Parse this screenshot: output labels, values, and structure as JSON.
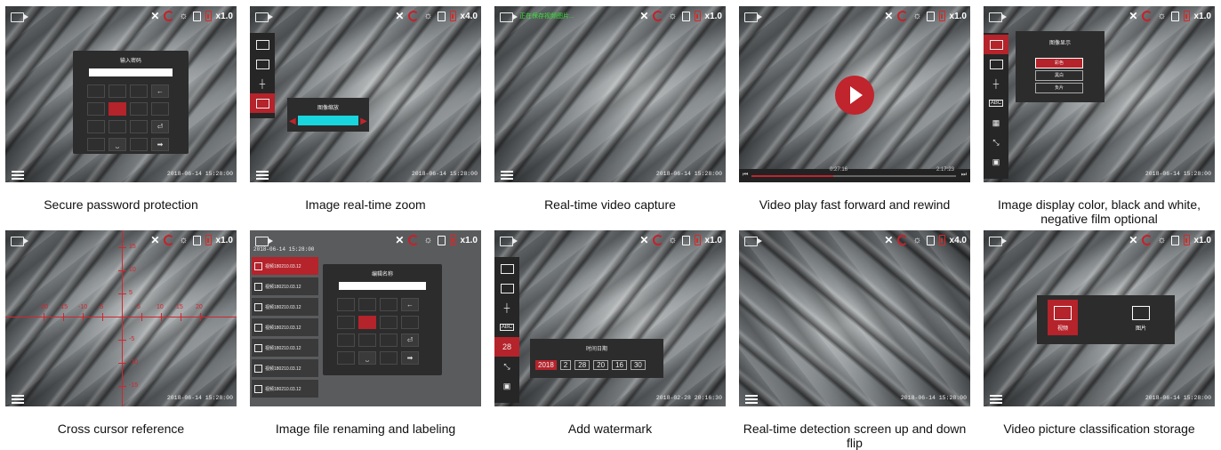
{
  "colors": {
    "accent_red": "#b5232b",
    "cyan": "#19d5de",
    "recording_text": "#3be03b"
  },
  "status": {
    "zoom": "x1.0",
    "zoom_4": "x4.0"
  },
  "date_strings": {
    "d1": "2018-06-14  15:28:00",
    "d2": "2018-06-14  15:28:00",
    "d3": "2018-06-14  15:28:00",
    "d5": "2018-06-14  15:28:00",
    "d6": "2018-06-14  15:28:00",
    "d7_top": "2018-06-14  15:28:00",
    "d8": "2018-02-28  20:16:30",
    "d9": "2018-06-14  15:28:00",
    "d10": "2018-06-14  15:28:00"
  },
  "cards": {
    "c1": {
      "caption": "Secure password protection",
      "dialog_title": "输入密码"
    },
    "c2": {
      "caption": "Image real-time zoom",
      "panel_title": "图像缩放"
    },
    "c3": {
      "caption": "Real-time video capture",
      "recording_text": "正在保存视频图片..."
    },
    "c4": {
      "caption": "Video play fast forward and rewind",
      "time_current": "0:27:16",
      "time_total": "2:17:23"
    },
    "c5": {
      "caption": "Image display color, black and white, negative film optional",
      "panel_title": "图像显示",
      "options": [
        "彩色",
        "黑白",
        "负片"
      ]
    },
    "c6": {
      "caption": "Cross cursor reference",
      "ticks_x": [
        "-20",
        "-15",
        "-10",
        "-5",
        "5",
        "10",
        "15",
        "20"
      ],
      "ticks_y": [
        "15",
        "10",
        "5",
        "-5",
        "-10",
        "-15"
      ]
    },
    "c7": {
      "caption": "Image file renaming and labeling",
      "dialog_title": "编辑名称",
      "files": [
        "视频180210.03.12",
        "视频180210.03.12",
        "视频180210.03.12",
        "视频180210.03.12",
        "视频180210.03.12",
        "视频180210.03.12",
        "视频180210.03.12"
      ]
    },
    "c8": {
      "caption": "Add watermark",
      "panel_title": "时间日期",
      "year": "2018",
      "month": "2",
      "day": "28",
      "hour": "20",
      "minute": "16",
      "second": "30",
      "calendar_day": "28"
    },
    "c9": {
      "caption": "Real-time detection screen up and down flip"
    },
    "c10": {
      "caption": "Video picture classification storage",
      "video_label": "视频",
      "picture_label": "图片"
    }
  },
  "icons": [
    "camera-icon",
    "close-icon",
    "record-icon",
    "brightness-icon",
    "sd-card-icon",
    "battery-icon",
    "menu-icon",
    "play-icon",
    "picture-icon",
    "calendar-icon"
  ]
}
